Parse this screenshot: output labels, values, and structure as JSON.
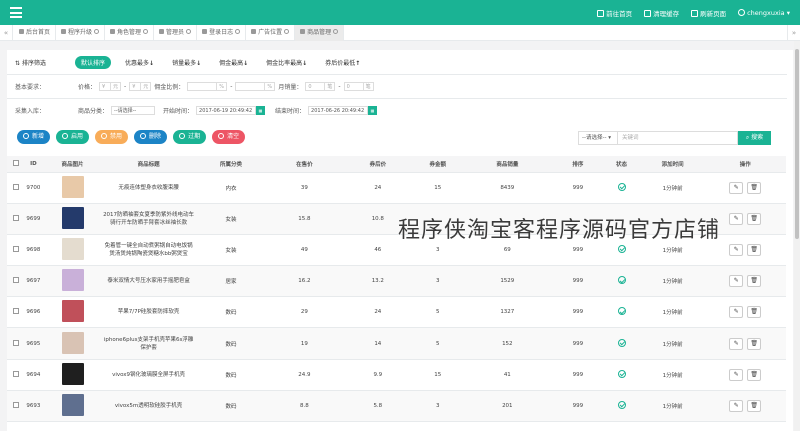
{
  "topbar": {
    "nav": [
      "前往首页",
      "清理缓存",
      "刷新页面",
      "chengxuxia"
    ],
    "accent": "#1ab394"
  },
  "tabs": [
    {
      "label": "后台首页",
      "icon": "home-icon"
    },
    {
      "label": "程序升级",
      "icon": "upgrade-icon"
    },
    {
      "label": "角色管理",
      "icon": "role-icon"
    },
    {
      "label": "管理员",
      "icon": "admin-icon"
    },
    {
      "label": "登录日志",
      "icon": "log-icon"
    },
    {
      "label": "广告位置",
      "icon": "ad-icon"
    },
    {
      "label": "商品管理",
      "icon": "goods-icon"
    }
  ],
  "filters": {
    "sort_label": "排序筛选",
    "sorts": [
      "默认排序",
      "优惠最多",
      "销量最多",
      "佣金最高",
      "佣金比率最高",
      "券后价最低"
    ],
    "basic_label": "基本要求：",
    "price_label": "价格：",
    "price_unit": "元",
    "commission_label": "佣金比例：",
    "percent": "%",
    "monthly_label": "月销量：",
    "monthly_unit": "笔",
    "collect_label": "采集入库：",
    "category_label": "商品分类：",
    "category_value": "--请选择--",
    "start_label": "开始时间：",
    "start_value": "2017-06-19 20:49:42",
    "end_label": "结束时间：",
    "end_value": "2017-06-26 20:49:42"
  },
  "buttons": [
    {
      "label": "新增",
      "color": "#1c84c6"
    },
    {
      "label": "启用",
      "color": "#1ab394"
    },
    {
      "label": "禁用",
      "color": "#f8ac59"
    },
    {
      "label": "删除",
      "color": "#1c84c6"
    },
    {
      "label": "过期",
      "color": "#1ab394"
    },
    {
      "label": "清空",
      "color": "#ed5565"
    }
  ],
  "search": {
    "select": "--请选择--",
    "placeholder": "关键词",
    "button": "搜索"
  },
  "table": {
    "headers": [
      "ID",
      "商品图片",
      "商品标题",
      "所属分类",
      "在售价",
      "券后价",
      "券金额",
      "商品销量",
      "排序",
      "状态",
      "添加时间",
      "操作"
    ],
    "rows": [
      {
        "id": "9700",
        "img": "#e8c9a8",
        "title": "无痕连体塑身衣收腹束腰",
        "cat": "内衣",
        "price": "39",
        "after": "24",
        "coupon": "15",
        "sales": "8439",
        "sort": "999",
        "time": "1分钟前"
      },
      {
        "id": "9699",
        "img": "#243a6b",
        "title": "2017防晒袖套女夏季防紫外线电动车骑行开车防晒手臂套冰丝袖长款",
        "cat": "女装",
        "price": "15.8",
        "after": "10.8",
        "coupon": "",
        "sales": "",
        "sort": "",
        "time": ""
      },
      {
        "id": "9698",
        "img": "#e4dccf",
        "title": "免着管一键全自动煮粥锅自动电饭锅煲汤煲炖锅陶瓷煲糖水bb粥煲宝",
        "cat": "女装",
        "price": "49",
        "after": "46",
        "coupon": "3",
        "sales": "69",
        "sort": "999",
        "time": "1分钟前"
      },
      {
        "id": "9697",
        "img": "#c9b0d9",
        "title": "泰米双情大号压水家用手摇肥皂盒",
        "cat": "居家",
        "price": "16.2",
        "after": "13.2",
        "coupon": "3",
        "sales": "1529",
        "sort": "999",
        "time": "1分钟前"
      },
      {
        "id": "9696",
        "img": "#c0505a",
        "title": "苹果7/7P硅胶套防摔软壳",
        "cat": "数码",
        "price": "29",
        "after": "24",
        "coupon": "5",
        "sales": "1327",
        "sort": "999",
        "time": "1分钟前"
      },
      {
        "id": "9695",
        "img": "#d9c3b4",
        "title": "iphone6plus支架手机壳苹果6s浮雕保护套",
        "cat": "数码",
        "price": "19",
        "after": "14",
        "coupon": "5",
        "sales": "152",
        "sort": "999",
        "time": "1分钟前"
      },
      {
        "id": "9694",
        "img": "#1f1f1f",
        "title": "vivox9钢化玻璃膜全屏手机壳",
        "cat": "数码",
        "price": "24.9",
        "after": "9.9",
        "coupon": "15",
        "sales": "41",
        "sort": "999",
        "time": "1分钟前"
      },
      {
        "id": "9693",
        "img": "#5f6f8f",
        "title": "vivox5m透明软硅胶手机壳",
        "cat": "数码",
        "price": "8.8",
        "after": "5.8",
        "coupon": "3",
        "sales": "201",
        "sort": "999",
        "time": "1分钟前"
      }
    ]
  },
  "watermark": "程序侠淘宝客程序源码官方店铺"
}
